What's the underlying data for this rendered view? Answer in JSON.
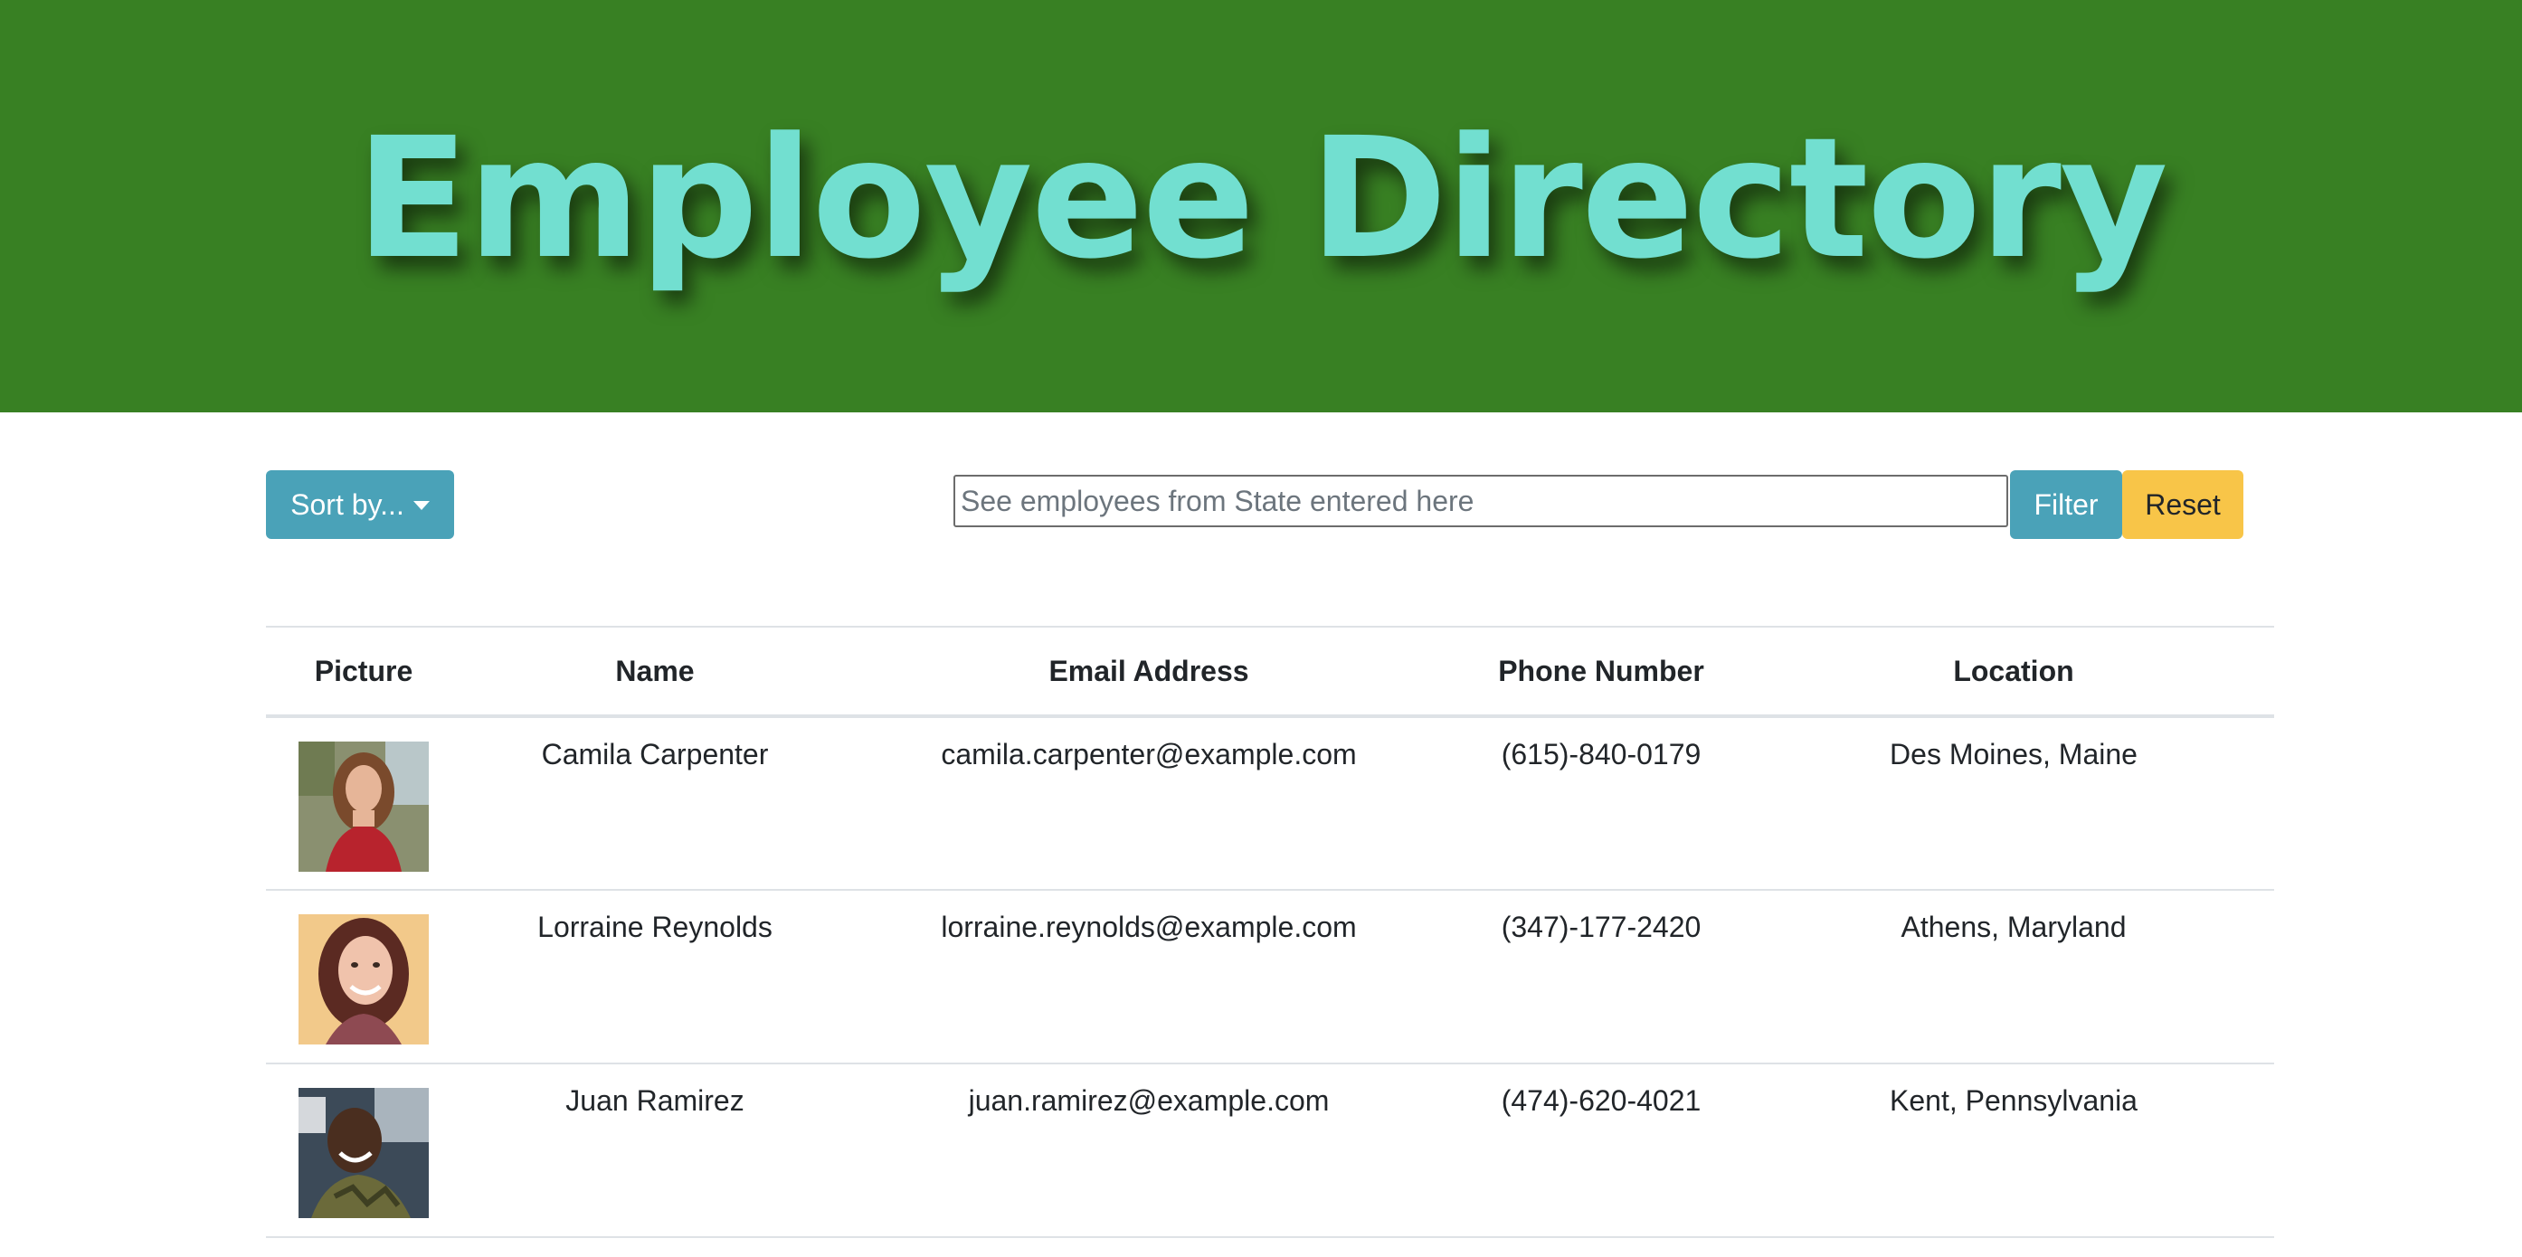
{
  "header": {
    "title": "Employee Directory"
  },
  "toolbar": {
    "sort_label": "Sort by...",
    "search_placeholder": "See employees from State entered here",
    "search_value": "",
    "filter_label": "Filter",
    "reset_label": "Reset"
  },
  "table": {
    "columns": [
      "Picture",
      "Name",
      "Email Address",
      "Phone Number",
      "Location"
    ],
    "rows": [
      {
        "avatar": "avatar-woman-red-dress",
        "name": "Camila Carpenter",
        "email": "camila.carpenter@example.com",
        "phone": "(615)-840-0179",
        "location": "Des Moines, Maine"
      },
      {
        "avatar": "avatar-woman-smiling",
        "name": "Lorraine Reynolds",
        "email": "lorraine.reynolds@example.com",
        "phone": "(347)-177-2420",
        "location": "Athens, Maryland"
      },
      {
        "avatar": "avatar-man-smiling",
        "name": "Juan Ramirez",
        "email": "juan.ramirez@example.com",
        "phone": "(474)-620-4021",
        "location": "Kent, Pennsylvania"
      }
    ]
  },
  "colors": {
    "header_bg": "#388023",
    "title_color": "#72dfd0",
    "info_button": "#4aa2b8",
    "warning_button": "#f8c548"
  }
}
